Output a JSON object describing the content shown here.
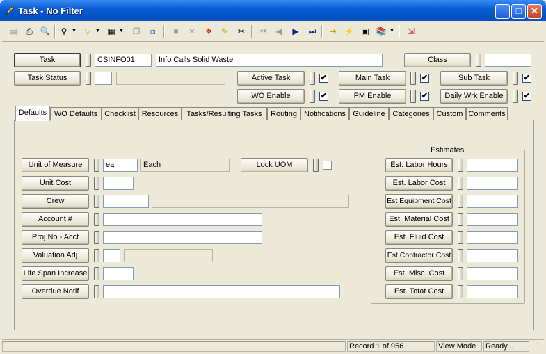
{
  "window": {
    "title": "Task - No Filter"
  },
  "header": {
    "task_label": "Task",
    "task_code": "CSINFO01",
    "task_desc": "Info Calls Solid Waste",
    "class_label": "Class",
    "class_value": "",
    "status_label": "Task Status",
    "status_code": "",
    "status_desc": "",
    "active_task_label": "Active Task",
    "active_task_checked": "✔",
    "main_task_label": "Main Task",
    "main_task_checked": "✔",
    "sub_task_label": "Sub Task",
    "sub_task_checked": "✔",
    "wo_enable_label": "WO Enable",
    "wo_enable_checked": "✔",
    "pm_enable_label": "PM Enable",
    "pm_enable_checked": "✔",
    "daily_wrk_label": "Daily Wrk Enable",
    "daily_wrk_checked": "✔"
  },
  "tabs": [
    {
      "label": "Defaults"
    },
    {
      "label": "WO Defaults"
    },
    {
      "label": "Checklist"
    },
    {
      "label": "Resources"
    },
    {
      "label": "Tasks/Resulting Tasks"
    },
    {
      "label": "Routing"
    },
    {
      "label": "Notifications"
    },
    {
      "label": "Guideline"
    },
    {
      "label": "Categories"
    },
    {
      "label": "Custom"
    },
    {
      "label": "Comments"
    }
  ],
  "defaults": {
    "uom_label": "Unit of Measure",
    "uom_code": "ea",
    "uom_desc": "Each",
    "lock_uom_label": "Lock UOM",
    "unit_cost_label": "Unit Cost",
    "crew_label": "Crew",
    "account_label": "Account #",
    "proj_label": "Proj No - Acct",
    "valuation_label": "Valuation Adj",
    "lifespan_label": "Life Span Increase",
    "overdue_label": "Overdue Notif"
  },
  "estimates": {
    "title": "Estimates",
    "items": [
      {
        "label": "Est. Labor Hours"
      },
      {
        "label": "Est. Labor Cost"
      },
      {
        "label": "Est Equipment Cost"
      },
      {
        "label": "Est. Material Cost"
      },
      {
        "label": "Est. Fluid Cost"
      },
      {
        "label": "Est Contractor Cost"
      },
      {
        "label": "Est. Misc. Cost"
      },
      {
        "label": "Est. Totat Cost"
      }
    ]
  },
  "status": {
    "record": "Record 1 of 956",
    "mode": "View Mode",
    "state": "Ready..."
  },
  "colors": {
    "titlebar": "#0553c9",
    "window": "#ece9d8"
  }
}
